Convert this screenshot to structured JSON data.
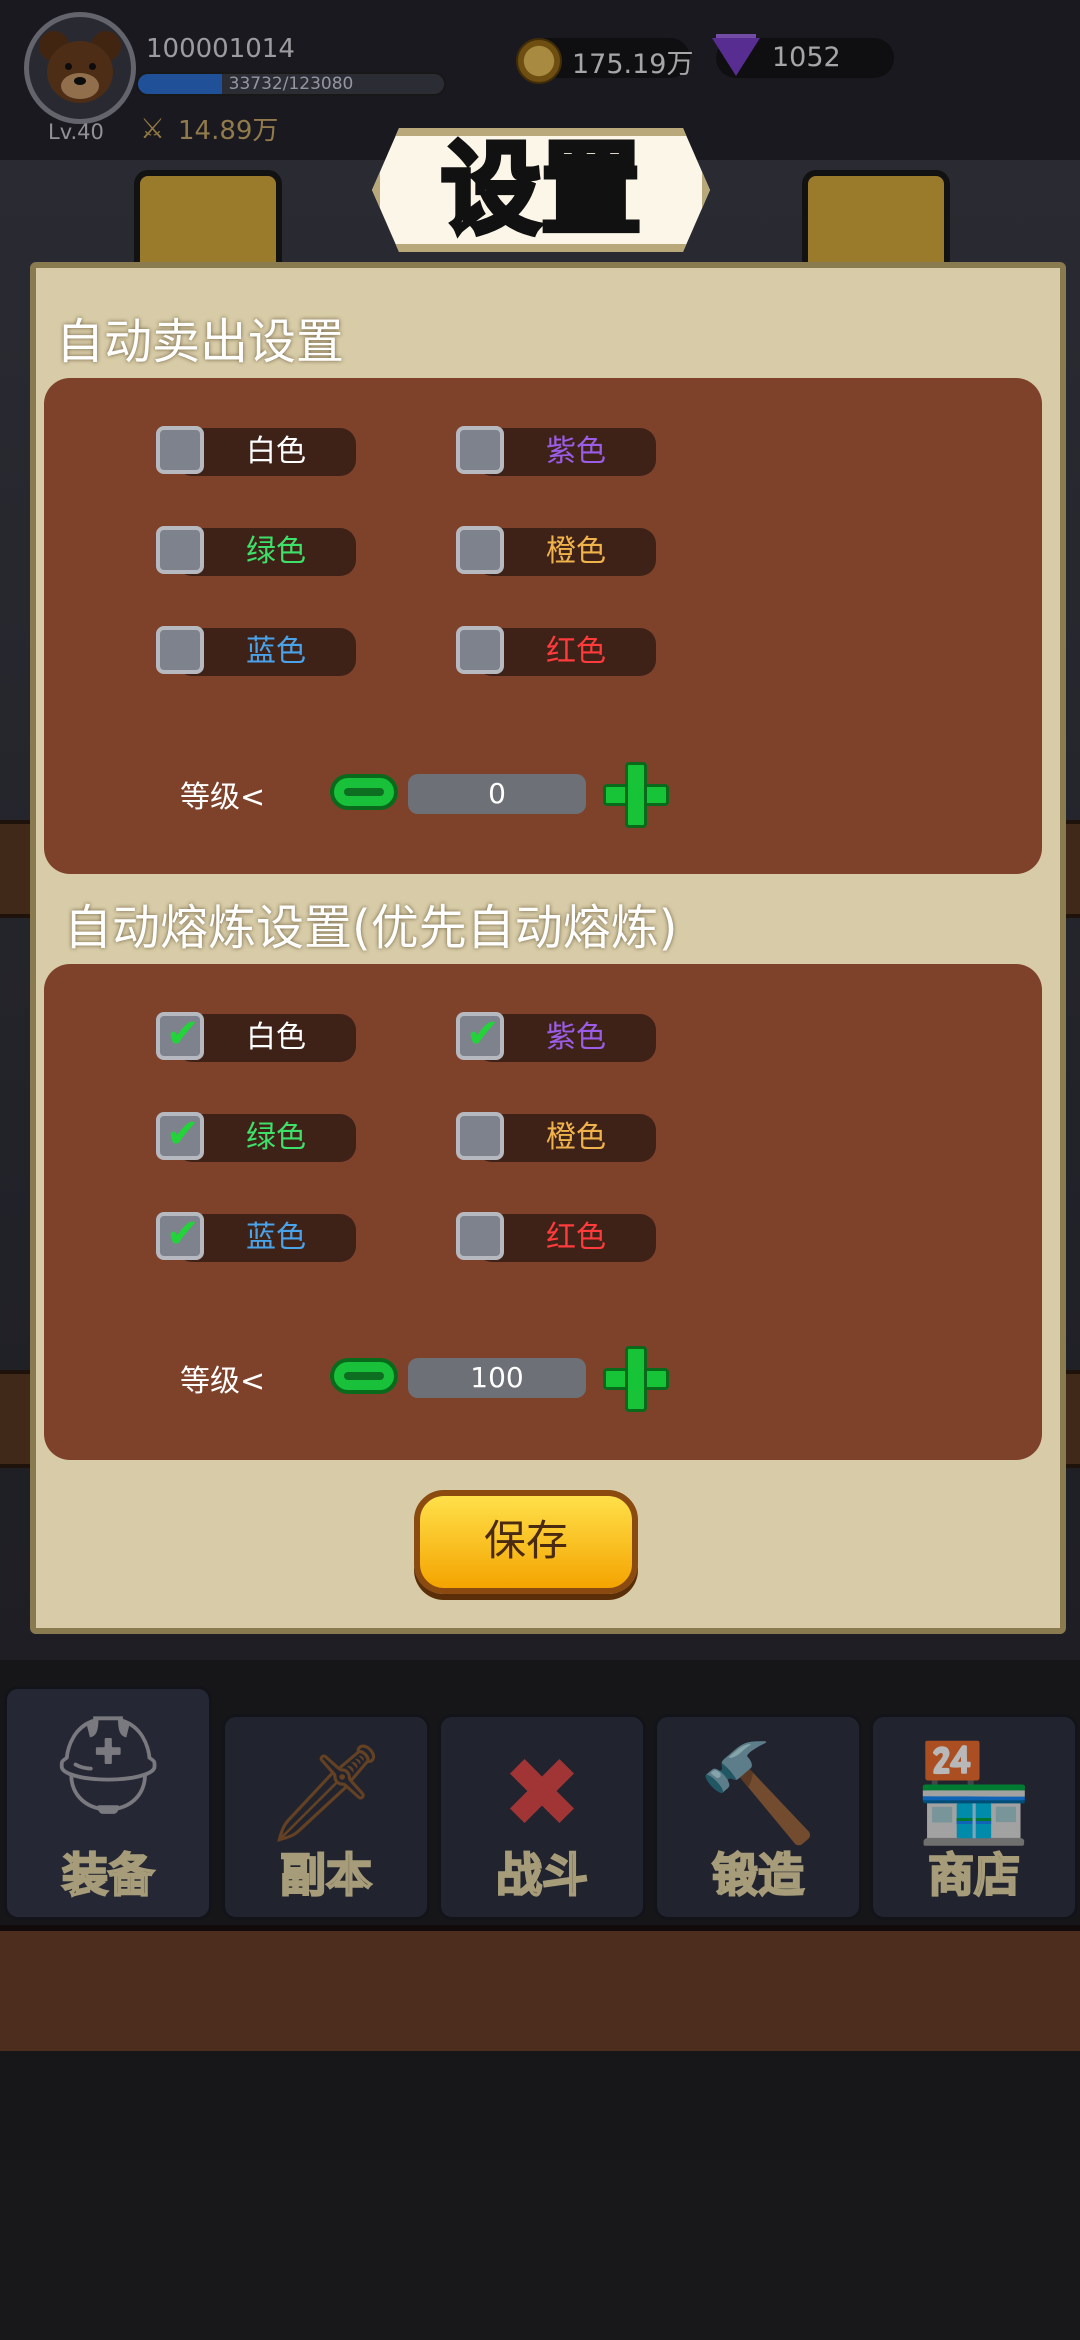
{
  "header": {
    "user_id": "100001014",
    "level": "Lv.40",
    "xp_text": "33732/123080",
    "xp_progress": 0.274,
    "power": "14.89万",
    "gold": "175.19万",
    "gems": "1052"
  },
  "modal": {
    "title": "设置",
    "auto_sell": {
      "title": "自动卖出设置",
      "options": [
        {
          "label": "白色",
          "checked": false,
          "color": "#ffffff"
        },
        {
          "label": "紫色",
          "checked": false,
          "color": "#9b5de5"
        },
        {
          "label": "绿色",
          "checked": false,
          "color": "#3ee06a"
        },
        {
          "label": "橙色",
          "checked": false,
          "color": "#f0b24a"
        },
        {
          "label": "蓝色",
          "checked": false,
          "color": "#4aa3e8"
        },
        {
          "label": "红色",
          "checked": false,
          "color": "#ff3b3b"
        }
      ],
      "level_label": "等级<",
      "level_value": "0"
    },
    "auto_smelt": {
      "title": "自动熔炼设置(优先自动熔炼)",
      "options": [
        {
          "label": "白色",
          "checked": true,
          "color": "#ffffff"
        },
        {
          "label": "紫色",
          "checked": true,
          "color": "#9b5de5"
        },
        {
          "label": "绿色",
          "checked": true,
          "color": "#3ee06a"
        },
        {
          "label": "橙色",
          "checked": false,
          "color": "#f0b24a"
        },
        {
          "label": "蓝色",
          "checked": true,
          "color": "#4aa3e8"
        },
        {
          "label": "红色",
          "checked": false,
          "color": "#ff3b3b"
        }
      ],
      "level_label": "等级<",
      "level_value": "100"
    },
    "save_label": "保存"
  },
  "nav": {
    "items": [
      {
        "label": "装备",
        "icon": "helmet-icon",
        "active": true
      },
      {
        "label": "副本",
        "icon": "sword-shield-icon",
        "active": false
      },
      {
        "label": "战斗",
        "icon": "battle-close-icon",
        "active": false
      },
      {
        "label": "锻造",
        "icon": "forge-scroll-icon",
        "active": false
      },
      {
        "label": "商店",
        "icon": "shop-icon",
        "active": false
      }
    ]
  }
}
